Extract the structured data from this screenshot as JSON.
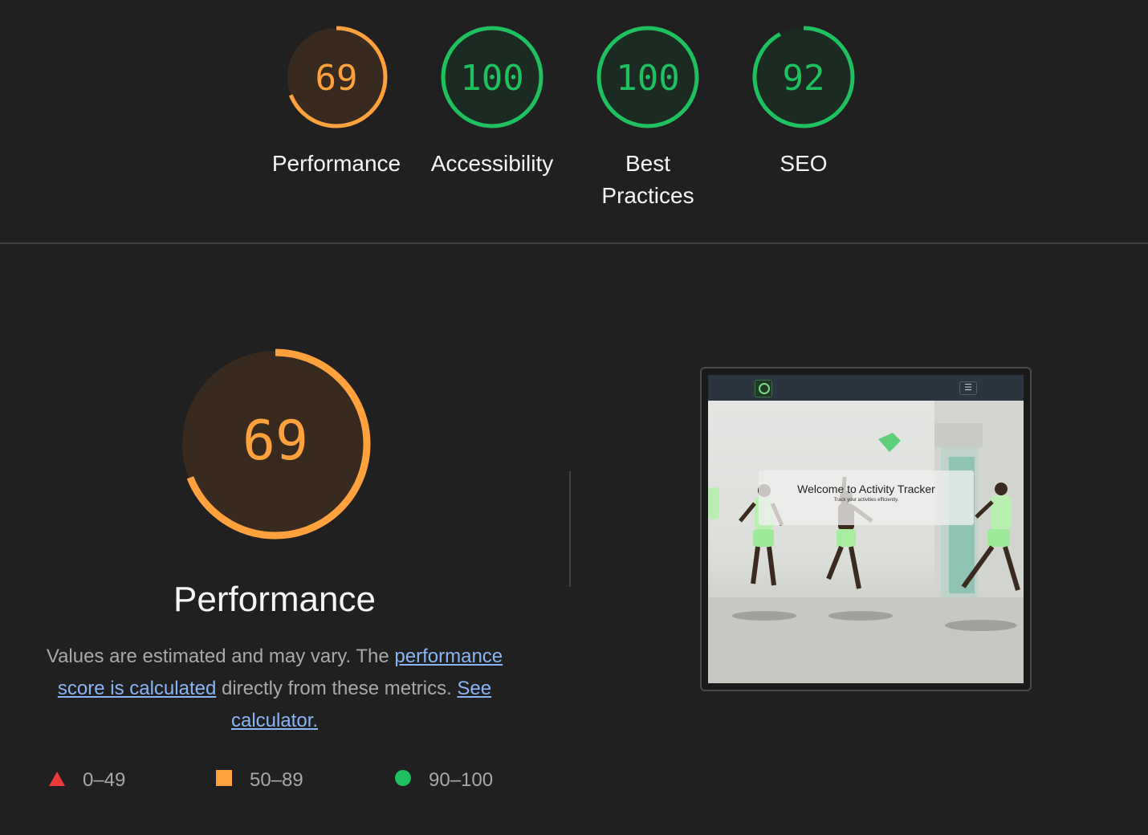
{
  "scores": [
    {
      "label": "Performance",
      "value": "69",
      "score": 69,
      "status": "average"
    },
    {
      "label": "Accessibility",
      "value": "100",
      "score": 100,
      "status": "pass"
    },
    {
      "label": "Best\nPractices",
      "label_line1": "Best",
      "label_line2": "Practices",
      "value": "100",
      "score": 100,
      "status": "pass"
    },
    {
      "label": "SEO",
      "value": "92",
      "score": 92,
      "status": "pass"
    }
  ],
  "performance": {
    "score": 69,
    "value": "69",
    "title": "Performance",
    "description_prefix": "Values are estimated and may vary. The ",
    "link_score": "performance score is calculated",
    "description_middle": " directly from these metrics. ",
    "link_calculator": "See calculator."
  },
  "legend": [
    {
      "range": "0–49",
      "shape": "triangle",
      "color": "#eb3a3a"
    },
    {
      "range": "50–89",
      "shape": "square",
      "color": "#ffa13c"
    },
    {
      "range": "90–100",
      "shape": "circle",
      "color": "#1fc15f"
    }
  ],
  "screenshot": {
    "hero_title": "Welcome to Activity Tracker",
    "hero_subtitle": "Track your activities efficiently.",
    "menu_icon": "hamburger-icon"
  },
  "colors": {
    "average": "#ffa13c",
    "average_bg": "#382a1f",
    "pass": "#1fc15f",
    "pass_bg": "#1b2b22",
    "background": "#202020"
  }
}
